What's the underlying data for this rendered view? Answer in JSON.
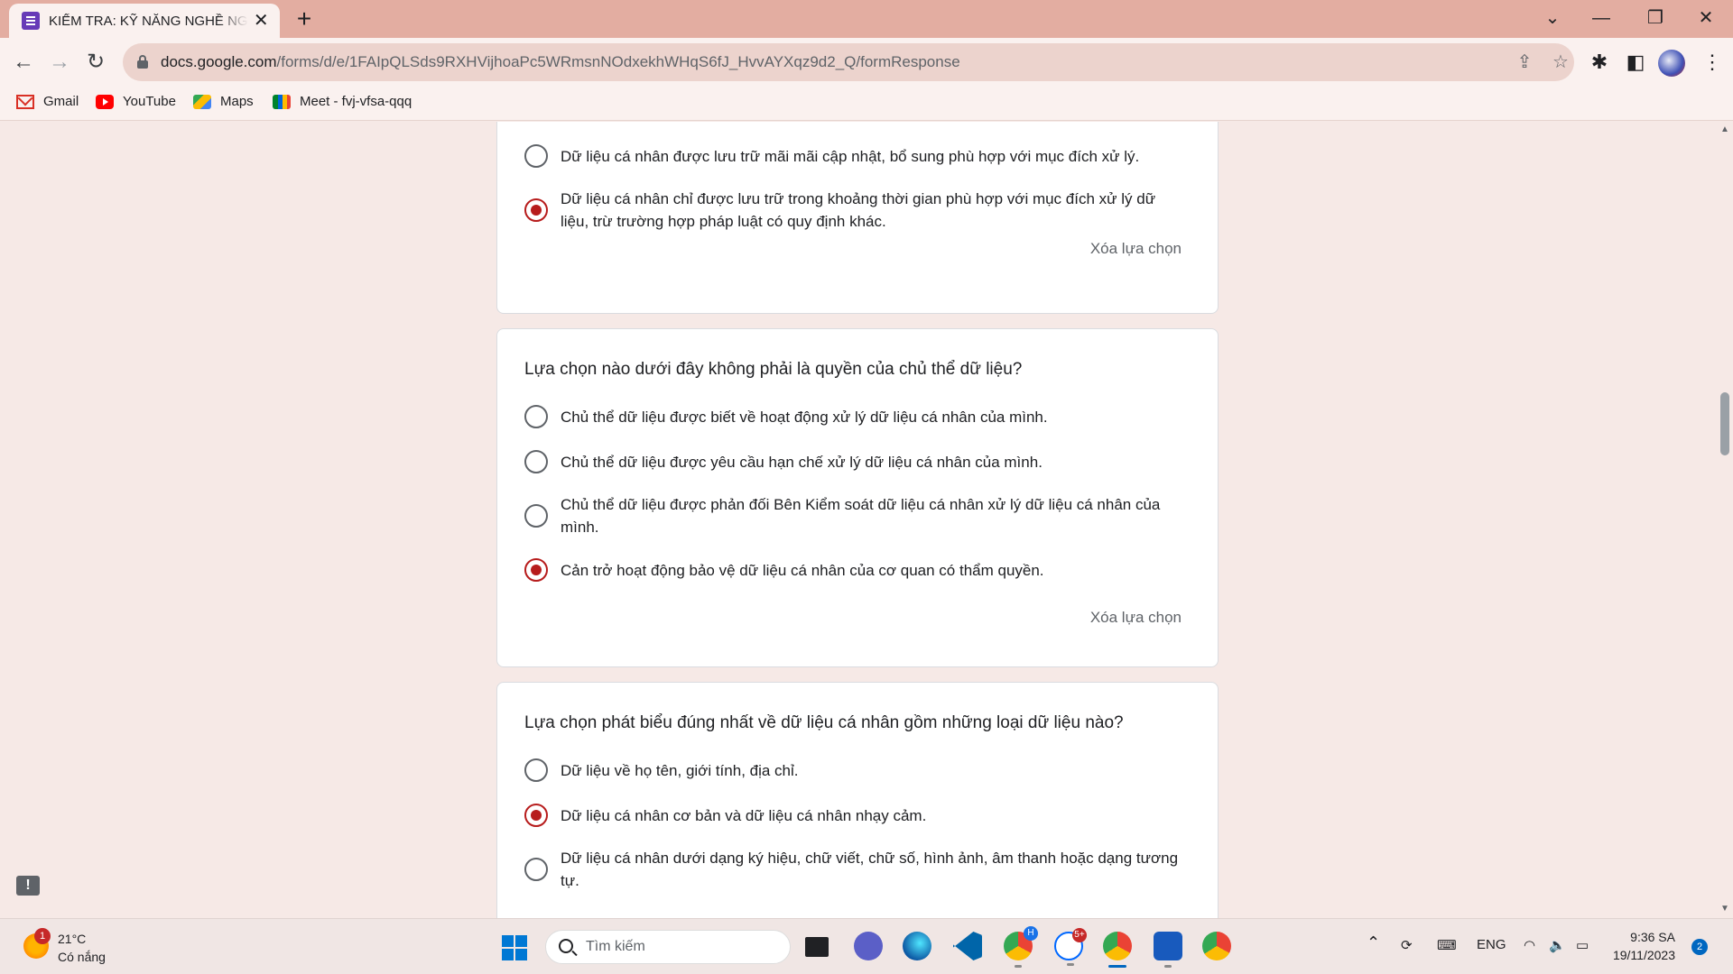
{
  "browser": {
    "tab_title": "KIỂM TRA: KỸ NĂNG NGHỀ NGHIỆP",
    "tab_close": "✕",
    "new_tab": "+",
    "url_host": "docs.google.com",
    "url_path": "/forms/d/e/1FAIpQLSds9RXHVijhoaPc5WRmsnNOdxekhWHqS6fJ_HvvAYXqz9d2_Q/formResponse",
    "window_controls": {
      "tabs_menu": "⌄",
      "minimize": "—",
      "restore": "❐",
      "close": "✕"
    }
  },
  "bookmarks": [
    {
      "label": "Gmail",
      "icon": "gmail-icon"
    },
    {
      "label": "YouTube",
      "icon": "youtube-icon"
    },
    {
      "label": "Maps",
      "icon": "maps-icon"
    },
    {
      "label": "Meet - fvj-vfsa-qqq",
      "icon": "meet-icon"
    }
  ],
  "form": {
    "cards": [
      {
        "question": "",
        "options": [
          {
            "label": "Dữ liệu cá nhân được lưu trữ mãi mãi cập nhật, bổ sung phù hợp với mục đích xử lý.",
            "selected": false
          },
          {
            "label": "Dữ liệu cá nhân chỉ được lưu trữ trong khoảng thời gian phù hợp với mục đích xử lý dữ liệu, trừ trường hợp pháp luật có quy định khác.",
            "selected": true
          }
        ],
        "clear_label": "Xóa lựa chọn"
      },
      {
        "question": "Lựa chọn nào dưới đây không phải là quyền của chủ thể dữ liệu?",
        "options": [
          {
            "label": "Chủ thể dữ liệu được biết về hoạt động xử lý dữ liệu cá nhân của mình.",
            "selected": false
          },
          {
            "label": "Chủ thể dữ liệu được yêu cầu hạn chế xử lý dữ liệu cá nhân của mình.",
            "selected": false
          },
          {
            "label": "Chủ thể dữ liệu được phản đối Bên Kiểm soát dữ liệu cá nhân xử lý dữ liệu cá nhân của mình.",
            "selected": false
          },
          {
            "label": "Cản trở hoạt động bảo vệ dữ liệu cá nhân của cơ quan có thẩm quyền.",
            "selected": true
          }
        ],
        "clear_label": "Xóa lựa chọn"
      },
      {
        "question": "Lựa chọn phát biểu đúng nhất về dữ liệu cá nhân gồm những loại dữ liệu nào?",
        "options": [
          {
            "label": "Dữ liệu về họ tên, giới tính, địa chỉ.",
            "selected": false
          },
          {
            "label": "Dữ liệu cá nhân cơ bản và dữ liệu cá nhân nhạy cảm.",
            "selected": true
          },
          {
            "label": "Dữ liệu cá nhân dưới dạng ký hiệu, chữ viết, chữ số, hình ảnh, âm thanh hoặc dạng tương tự.",
            "selected": false
          }
        ]
      }
    ]
  },
  "taskbar": {
    "weather": {
      "badge": "1",
      "temp": "21°C",
      "condition": "Có nắng"
    },
    "search_placeholder": "Tìm kiếm",
    "apps": [
      {
        "name": "task-view-icon"
      },
      {
        "name": "meet-now-icon"
      },
      {
        "name": "edge-icon"
      },
      {
        "name": "vscode-icon"
      },
      {
        "name": "chrome-profile-h-icon",
        "badge": "H"
      },
      {
        "name": "zalo-icon",
        "badge": "5+"
      },
      {
        "name": "chrome-icon"
      },
      {
        "name": "word-icon"
      },
      {
        "name": "chrome-profile-2-icon"
      }
    ],
    "tray": {
      "language": "ENG",
      "time": "9:36 SA",
      "date": "19/11/2023",
      "notifications": "2"
    }
  },
  "colors": {
    "accent": "#b71c1c",
    "background": "#f6e9e6",
    "tabbar": "#e3ada1"
  }
}
